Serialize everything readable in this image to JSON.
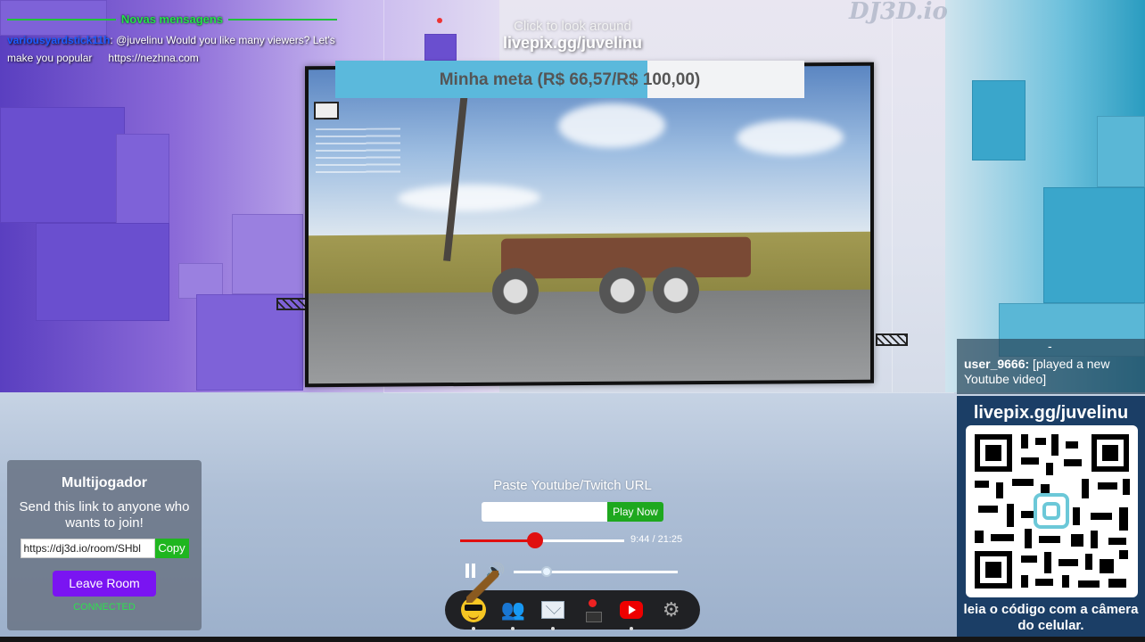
{
  "scene": {
    "watermark": "DJ3D.io",
    "hint": "Click to look around",
    "livepix_link": "livepix.gg/juvelinu"
  },
  "chat": {
    "header": "Novas mensagens",
    "messages": [
      {
        "user": "variousyardstick11h",
        "text": ": @juvelinu Would you like many viewers? Let's make you popular",
        "link": "https://nezhna.com"
      }
    ]
  },
  "goal": {
    "label": "Minha meta (R$ 66,57/R$ 100,00)",
    "current": 66.57,
    "target": 100.0,
    "fill_color": "#5bb9dc"
  },
  "multiplayer": {
    "title": "Multijogador",
    "description": "Send this link to anyone who wants to join!",
    "room_link": "https://dj3d.io/room/SHbl",
    "copy_label": "Copy",
    "leave_label": "Leave Room",
    "status": "CONNECTED"
  },
  "player": {
    "prompt": "Paste Youtube/Twitch URL",
    "url_value": "",
    "play_label": "Play Now",
    "time": "9:44 / 21:25",
    "progress": 0.458,
    "volume": 0.2
  },
  "dock": {
    "items": [
      {
        "name": "emoji-icon"
      },
      {
        "name": "people-icon"
      },
      {
        "name": "mail-icon"
      },
      {
        "name": "joystick-icon"
      },
      {
        "name": "youtube-icon"
      },
      {
        "name": "gear-icon"
      }
    ]
  },
  "notice": {
    "dash": "-",
    "user": "user_9666:",
    "text": " [played a new Youtube video]"
  },
  "qr": {
    "link": "livepix.gg/juvelinu",
    "caption": "leia o código com a câmera do celular."
  },
  "colors": {
    "accent_purple": "#7a14f2",
    "play_green": "#1ea81e",
    "seek_red": "#e01010",
    "chat_green": "#24e24a",
    "qr_panel": "#1b3e66"
  }
}
